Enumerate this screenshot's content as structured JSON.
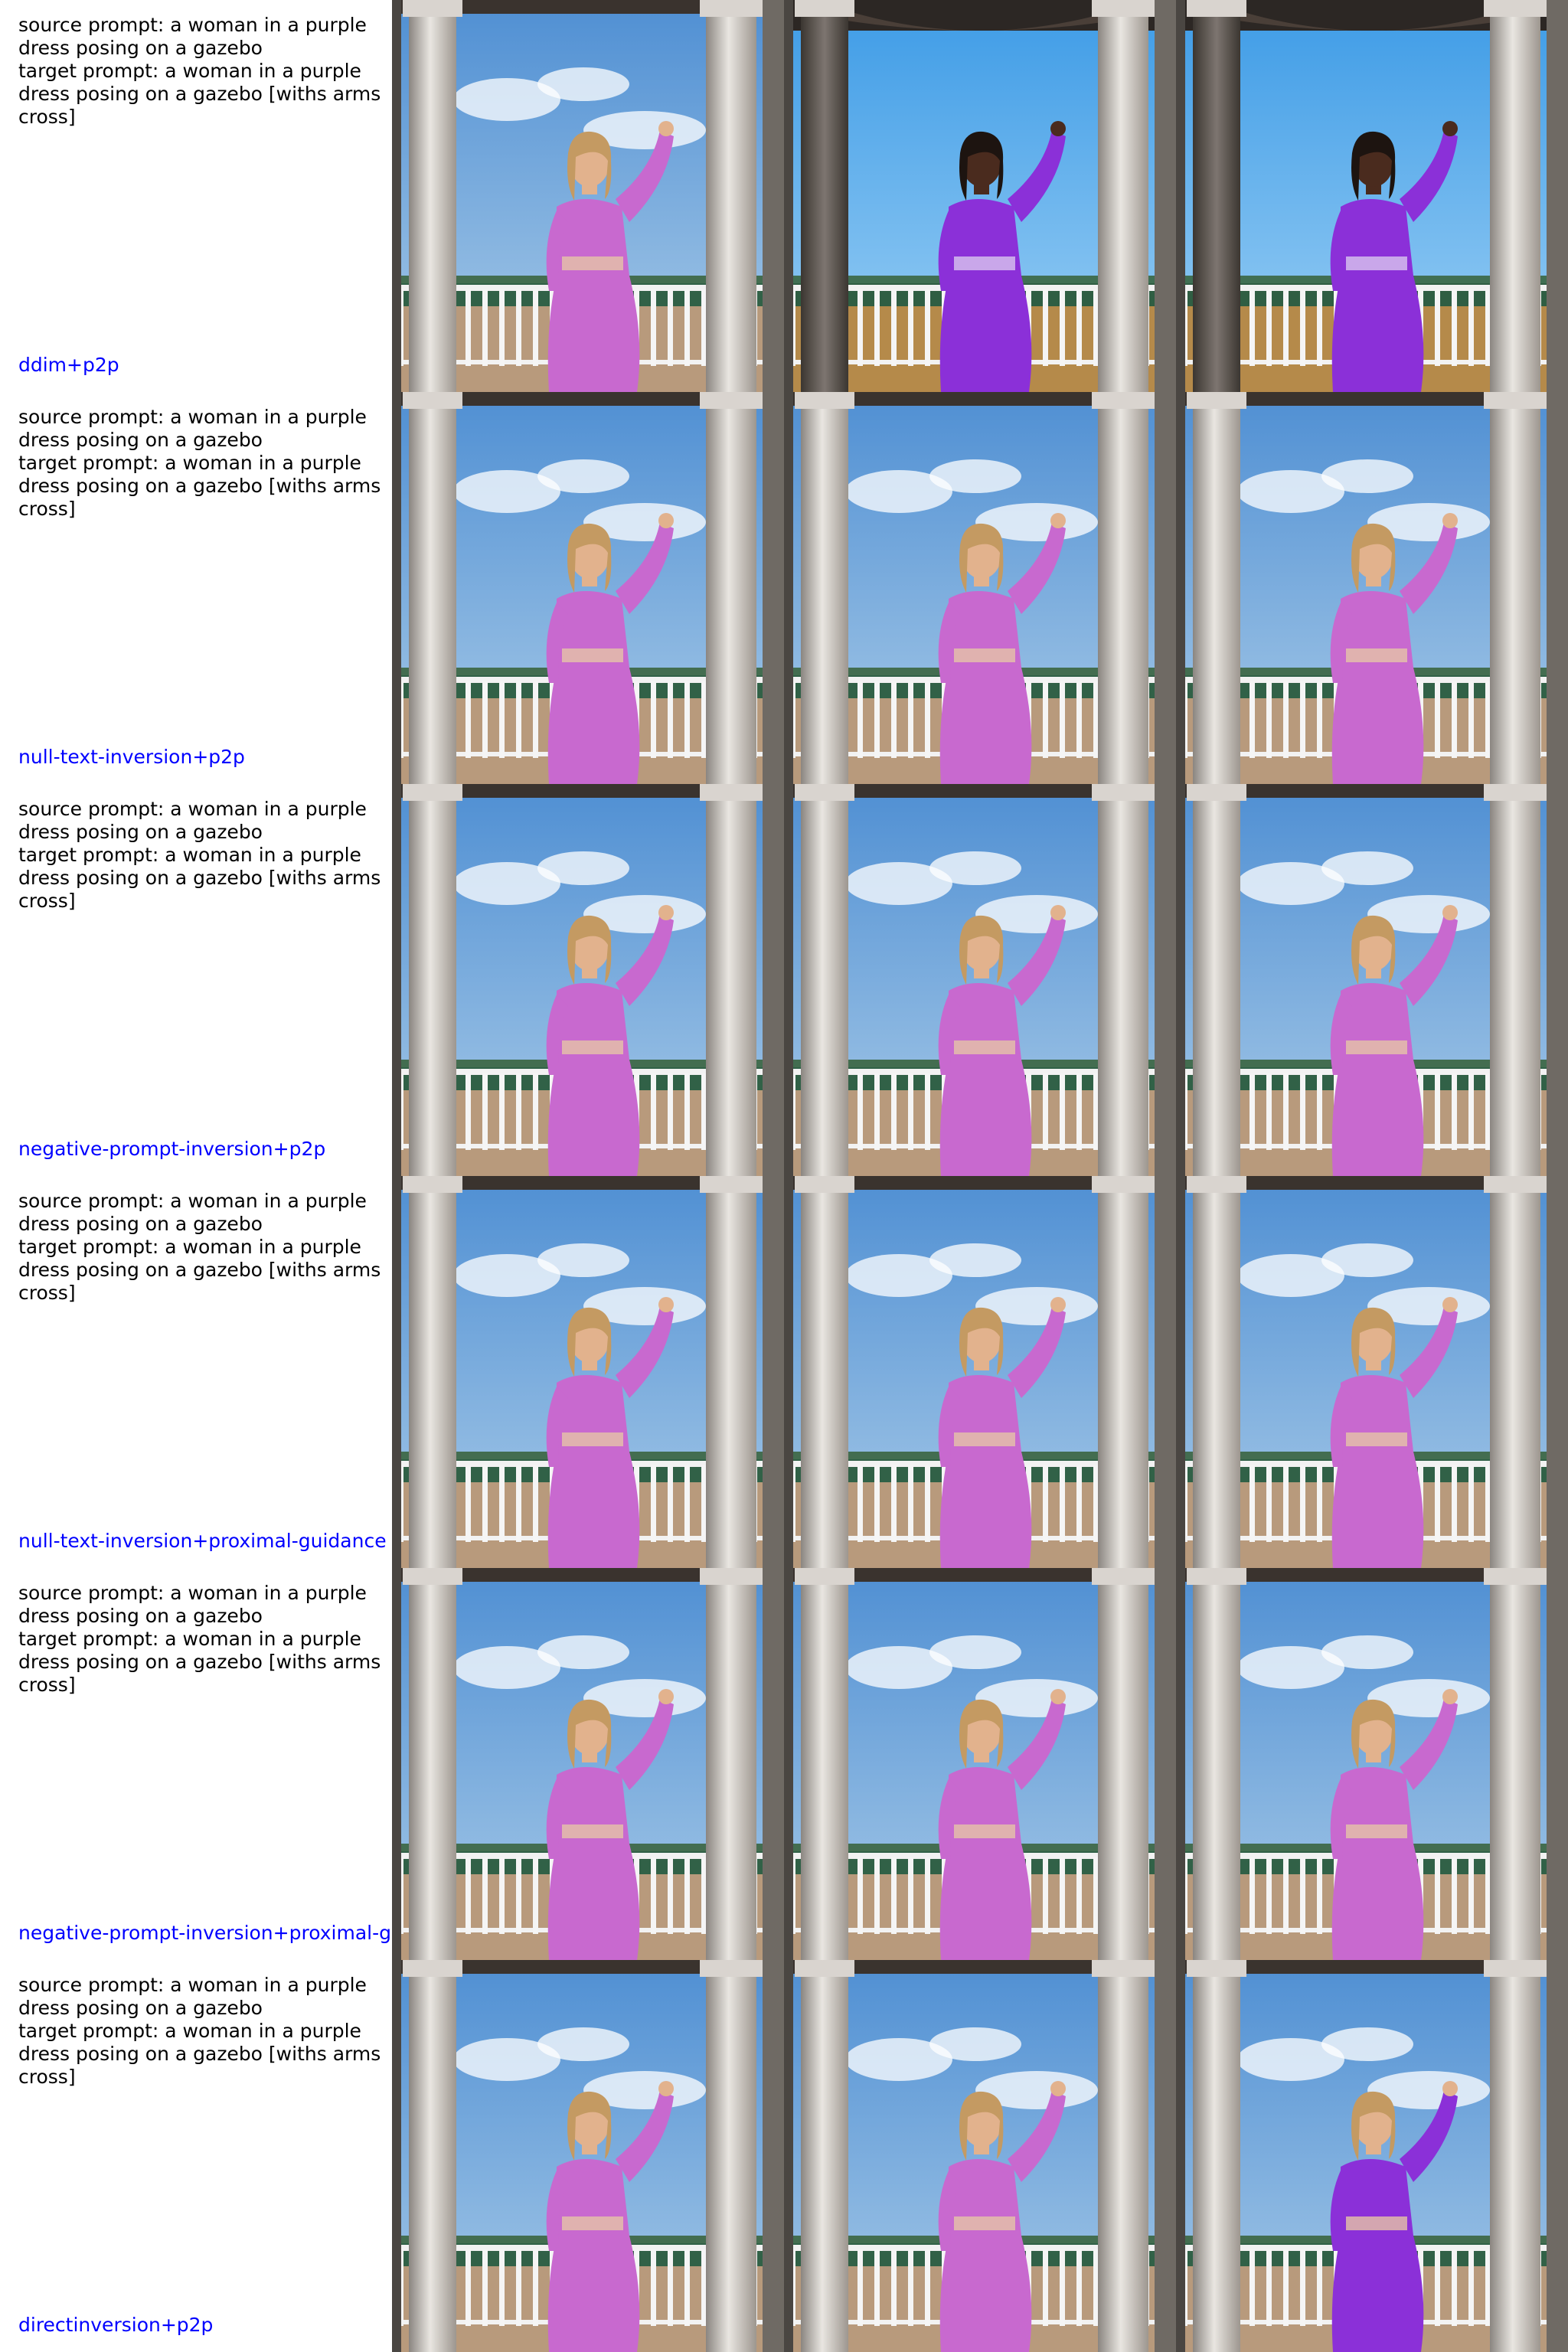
{
  "rows": [
    {
      "prompt": "source prompt: a woman in a purple\ndress posing on a gazebo\ntarget prompt: a woman in a purple\ndress posing on a gazebo [withs arms\ncross]",
      "method": "ddim+p2p"
    },
    {
      "prompt": "source prompt: a woman in a purple\ndress posing on a gazebo\ntarget prompt: a woman in a purple\ndress posing on a gazebo [withs arms\ncross]",
      "method": "null-text-inversion+p2p"
    },
    {
      "prompt": "source prompt: a woman in a purple\ndress posing on a gazebo\ntarget prompt: a woman in a purple\ndress posing on a gazebo [withs arms\ncross]",
      "method": "negative-prompt-inversion+p2p"
    },
    {
      "prompt": "source prompt: a woman in a purple\ndress posing on a gazebo\ntarget prompt: a woman in a purple\ndress posing on a gazebo [withs arms\ncross]",
      "method": "null-text-inversion+proximal-guidance"
    },
    {
      "prompt": "source prompt: a woman in a purple\ndress posing on a gazebo\ntarget prompt: a woman in a purple\ndress posing on a gazebo [withs arms\ncross]",
      "method": "negative-prompt-inversion+proximal-g"
    },
    {
      "prompt": "source prompt: a woman in a purple\ndress posing on a gazebo\ntarget prompt: a woman in a purple\ndress posing on a gazebo [withs arms\ncross]",
      "method": "directinversion+p2p"
    }
  ],
  "colors": {
    "label_blue": "#0000ff",
    "sky": "#5b9bd8",
    "dress_pink": "#c15fc9",
    "dress_violet": "#8a2be2"
  }
}
